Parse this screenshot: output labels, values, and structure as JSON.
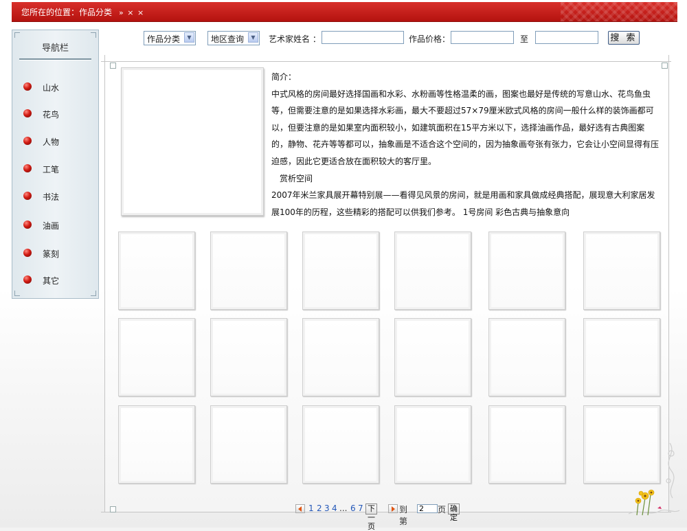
{
  "breadcrumb": {
    "prefix": "您所在的位置：",
    "current": "作品分类",
    "suffix": "»  × ×"
  },
  "sidebar": {
    "title": "导航栏",
    "items": [
      "山水",
      "花鸟",
      "人物",
      "工笔",
      "书法",
      "油画",
      "篆刻",
      "其它"
    ]
  },
  "search": {
    "category_select": "作品分类",
    "region_select": "地区查询",
    "artist_label": "艺术家姓名 ：",
    "artist_value": "",
    "price_label": "作品价格：",
    "price_min": "",
    "to_label": "至",
    "price_max": "",
    "search_button": "搜 索"
  },
  "intro": {
    "heading": "简介：",
    "paragraph1": "中式风格的房间最好选择国画和水彩、水粉画等性格温柔的画，图案也最好是传统的写意山水、花鸟鱼虫等，但需要注意的是如果选择水彩画，最大不要超过57×79厘米欧式风格的房间一般什么样的装饰画都可以，但要注意的是如果室内面积较小，如建筑面积在15平方米以下，选择油画作品，最好选有古典图案的，静物、花卉等等都可以，抽象画是不适合这个空间的，因为抽象画夸张有张力，它会让小空间显得有压迫感，因此它更适合放在面积较大的客厅里。",
    "subheading": "　赏析空间",
    "paragraph2": "2007年米兰家具展开幕特别展——看得见风景的房间，就是用画和家具做成经典搭配，展现意大利家居发展100年的历程，这些精彩的搭配可以供我们参考。 1号房间 彩色古典与抽象意向"
  },
  "gallery": {
    "rows": 3,
    "cols": 6
  },
  "pagination": {
    "pages": [
      "1",
      "2",
      "3",
      "4"
    ],
    "ellipsis": "...",
    "tail_pages": [
      "6",
      "7"
    ],
    "next_label": "下一页",
    "goto_label": "到第",
    "goto_value": "2",
    "page_unit": "页",
    "confirm_label": "确定"
  },
  "icons": {
    "prev": "prev-arrow-icon",
    "next": "next-arrow-icon",
    "bullet": "red-bead-icon",
    "select": "dropdown-arrow-icon"
  },
  "colors": {
    "banner": "#c31d19",
    "bullet": "#d21b13",
    "link": "#2357b8"
  }
}
